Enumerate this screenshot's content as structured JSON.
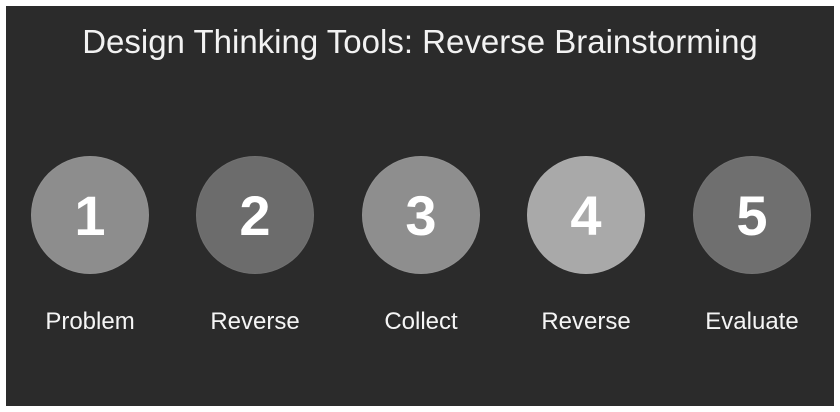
{
  "title": "Design Thinking Tools: Reverse Brainstorming",
  "steps": [
    {
      "number": "1",
      "label": "Problem",
      "color": "#8d8d8d"
    },
    {
      "number": "2",
      "label": "Reverse",
      "color": "#6c6c6c"
    },
    {
      "number": "3",
      "label": "Collect",
      "color": "#8e8e8e"
    },
    {
      "number": "4",
      "label": "Reverse",
      "color": "#a9a9a9"
    },
    {
      "number": "5",
      "label": "Evaluate",
      "color": "#6f6f6f"
    }
  ]
}
